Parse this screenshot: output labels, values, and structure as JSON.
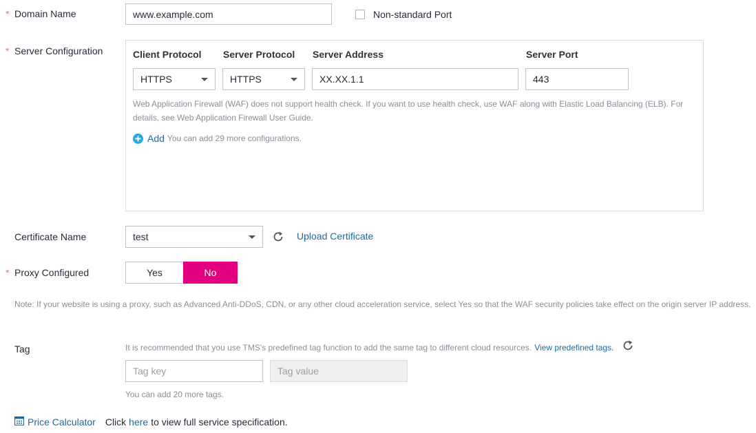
{
  "domain": {
    "label": "Domain Name",
    "value": "www.example.com",
    "non_standard_port_label": "Non-standard Port",
    "non_standard_port_checked": false
  },
  "server_config": {
    "label": "Server Configuration",
    "headers": [
      "Client Protocol",
      "Server Protocol",
      "Server Address",
      "Server Port"
    ],
    "row": {
      "client_protocol": "HTTPS",
      "server_protocol": "HTTPS",
      "server_address": "XX.XX.1.1",
      "server_port": "443"
    },
    "note_line1": "Web Application Firewall (WAF) does not support health check. If you want to use health check, use WAF along with Elastic Load Balancing (ELB). For",
    "note_line2": "details, see Web Application Firewall User Guide.",
    "add_label": "Add",
    "add_hint": "You can add 29 more configurations."
  },
  "certificate": {
    "label": "Certificate Name",
    "value": "test",
    "upload_label": "Upload Certificate"
  },
  "proxy": {
    "label": "Proxy Configured",
    "yes_label": "Yes",
    "no_label": "No",
    "selected": "No",
    "note": "Note: If your website is using a proxy, such as Advanced Anti-DDoS, CDN, or any other cloud acceleration service, select Yes so that the WAF security policies take effect on the origin server IP address."
  },
  "tag": {
    "label": "Tag",
    "hint": "It is recommended that you use TMS's predefined tag function to add the same tag to different cloud resources.",
    "hint_link": "View predefined tags.",
    "key_placeholder": "Tag key",
    "value_placeholder": "Tag value",
    "remaining": "You can add 20 more tags."
  },
  "footer": {
    "calc_label": "Price Calculator",
    "click_text": "Click",
    "here_link": "here",
    "after_text": "to view full service specification."
  },
  "colors": {
    "accent": "#e3007f",
    "link": "#1a6ba0",
    "required": "#f66f6a",
    "add_icon": "#2ba7e0"
  }
}
